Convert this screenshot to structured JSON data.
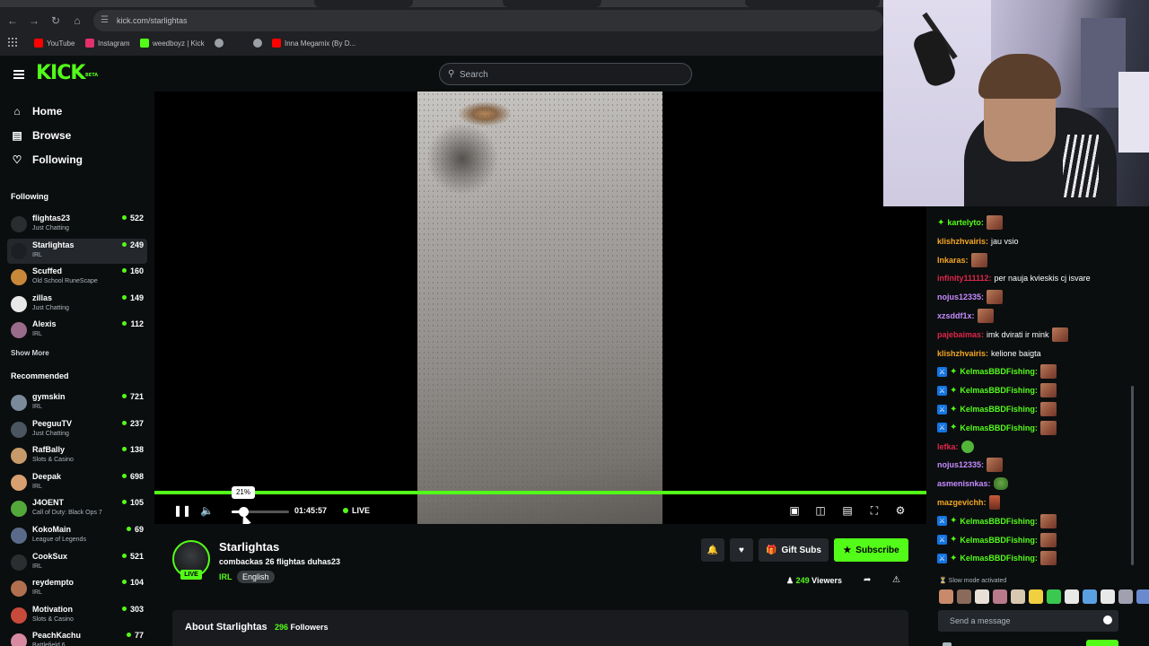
{
  "browser": {
    "url": "kick.com/starlightas",
    "bookmarks": [
      {
        "label": "YouTube",
        "color": "#ff0000"
      },
      {
        "label": "Instagram",
        "color": "#e1306c"
      },
      {
        "label": "weedboyz | Kick",
        "color": "#53fc18"
      },
      {
        "label": "",
        "color": "#9aa0a6"
      },
      {
        "label": "",
        "color": "#9aa0a6"
      },
      {
        "label": "Inna Megamix (By D...",
        "color": "#ff0000"
      }
    ]
  },
  "topbar": {
    "logo": "KICK",
    "logo_badge": "BETA",
    "search_placeholder": "Search"
  },
  "sidebar": {
    "nav": [
      {
        "label": "Home",
        "icon": "home-icon"
      },
      {
        "label": "Browse",
        "icon": "browse-icon"
      },
      {
        "label": "Following",
        "icon": "heart-icon"
      }
    ],
    "following_title": "Following",
    "following": [
      {
        "name": "flightas23",
        "category": "Just Chatting",
        "viewers": "522",
        "color": "#2a2d30"
      },
      {
        "name": "Starlightas",
        "category": "IRL",
        "viewers": "249",
        "color": "#1d1f22",
        "active": true
      },
      {
        "name": "Scuffed",
        "category": "Old School RuneScape",
        "viewers": "160",
        "color": "#c8883a"
      },
      {
        "name": "zillas",
        "category": "Just Chatting",
        "viewers": "149",
        "color": "#e8e8e8"
      },
      {
        "name": "Alexis",
        "category": "IRL",
        "viewers": "112",
        "color": "#9a6b8a"
      }
    ],
    "show_more": "Show More",
    "recommended_title": "Recommended",
    "recommended": [
      {
        "name": "gymskin",
        "category": "IRL",
        "viewers": "721",
        "color": "#7a8a9a"
      },
      {
        "name": "PeeguuTV",
        "category": "Just Chatting",
        "viewers": "237",
        "color": "#4a5560"
      },
      {
        "name": "RafBally",
        "category": "Slots & Casino",
        "viewers": "138",
        "color": "#c89a6a"
      },
      {
        "name": "Deepak",
        "category": "IRL",
        "viewers": "698",
        "color": "#d8a070"
      },
      {
        "name": "J4OENT",
        "category": "Call of Duty: Black Ops 7",
        "viewers": "105",
        "color": "#53a83a"
      },
      {
        "name": "KokoMain",
        "category": "League of Legends",
        "viewers": "69",
        "color": "#5a6a8a"
      },
      {
        "name": "CookSux",
        "category": "IRL",
        "viewers": "521",
        "color": "#2b2e30"
      },
      {
        "name": "reydempto",
        "category": "IRL",
        "viewers": "104",
        "color": "#b07050"
      },
      {
        "name": "Motivation",
        "category": "Slots & Casino",
        "viewers": "303",
        "color": "#c84a3a"
      },
      {
        "name": "PeachKachu",
        "category": "Battlefield 6",
        "viewers": "77",
        "color": "#d88aa0"
      }
    ]
  },
  "player": {
    "volume_tooltip": "21%",
    "volume_level": 0.21,
    "timecode": "01:45:57",
    "live_label": "LIVE"
  },
  "stream": {
    "live_badge": "LIVE",
    "name": "Starlightas",
    "title": "combackas 26 flightas duhas23",
    "category": "IRL",
    "tag": "English",
    "gift_label": "Gift Subs",
    "subscribe_label": "Subscribe",
    "viewers_count": "249",
    "viewers_label": "Viewers",
    "about_title": "About Starlightas",
    "followers_count": "296",
    "followers_label": "Followers"
  },
  "chat": {
    "messages": [
      {
        "user": "kartelyto:",
        "color": "#53fc18",
        "text": "",
        "badges": [
          "gift"
        ],
        "emote": "face"
      },
      {
        "user": "klishzhvairis:",
        "color": "#f5a623",
        "text": "jau vsio",
        "badges": [],
        "emote": ""
      },
      {
        "user": "Inkaras:",
        "color": "#f5a623",
        "text": "",
        "badges": [],
        "emote": "face"
      },
      {
        "user": "infinity111112:",
        "color": "#e0264a",
        "text": "per nauja kvieskis cj isvare",
        "badges": [],
        "emote": ""
      },
      {
        "user": "nojus12335:",
        "color": "#c58cff",
        "text": "",
        "badges": [],
        "emote": "face"
      },
      {
        "user": "xzsddf1x:",
        "color": "#c58cff",
        "text": "",
        "badges": [],
        "emote": "face"
      },
      {
        "user": "pajebaimas:",
        "color": "#e0264a",
        "text": "imk dvirati ir mink",
        "badges": [],
        "emote": "face"
      },
      {
        "user": "klishzhvairis:",
        "color": "#f5a623",
        "text": "kelione baigta",
        "badges": [],
        "emote": ""
      },
      {
        "user": "KelmasBBDFishing:",
        "color": "#53fc18",
        "text": "",
        "badges": [
          "mod",
          "gift"
        ],
        "emote": "face"
      },
      {
        "user": "KelmasBBDFishing:",
        "color": "#53fc18",
        "text": "",
        "badges": [
          "mod",
          "gift"
        ],
        "emote": "face"
      },
      {
        "user": "KelmasBBDFishing:",
        "color": "#53fc18",
        "text": "",
        "badges": [
          "mod",
          "gift"
        ],
        "emote": "face"
      },
      {
        "user": "KelmasBBDFishing:",
        "color": "#53fc18",
        "text": "",
        "badges": [
          "mod",
          "gift"
        ],
        "emote": "face"
      },
      {
        "user": "lefka:",
        "color": "#e0264a",
        "text": "",
        "badges": [],
        "emote": "green"
      },
      {
        "user": "nojus12335:",
        "color": "#c58cff",
        "text": "",
        "badges": [],
        "emote": "face"
      },
      {
        "user": "asmenisnkas:",
        "color": "#c58cff",
        "text": "",
        "badges": [],
        "emote": "pepe"
      },
      {
        "user": "mazgevichh:",
        "color": "#f5a623",
        "text": "",
        "badges": [],
        "emote": "small"
      },
      {
        "user": "KelmasBBDFishing:",
        "color": "#53fc18",
        "text": "",
        "badges": [
          "mod",
          "gift"
        ],
        "emote": "face"
      },
      {
        "user": "KelmasBBDFishing:",
        "color": "#53fc18",
        "text": "",
        "badges": [
          "mod",
          "gift"
        ],
        "emote": "face"
      },
      {
        "user": "KelmasBBDFishing:",
        "color": "#53fc18",
        "text": "",
        "badges": [
          "mod",
          "gift"
        ],
        "emote": "face"
      }
    ],
    "slow_mode": "Slow mode activated",
    "emote_colors": [
      "#c88a6a",
      "#8a6a5a",
      "#e8e0d8",
      "#b87a8a",
      "#d8c8b0",
      "#f0d040",
      "#3ac850",
      "#e8e8e8",
      "#5aa0e0",
      "#e8e8e8",
      "#a0a0b0",
      "#6a8ad0"
    ],
    "input_placeholder": "Send a message"
  }
}
